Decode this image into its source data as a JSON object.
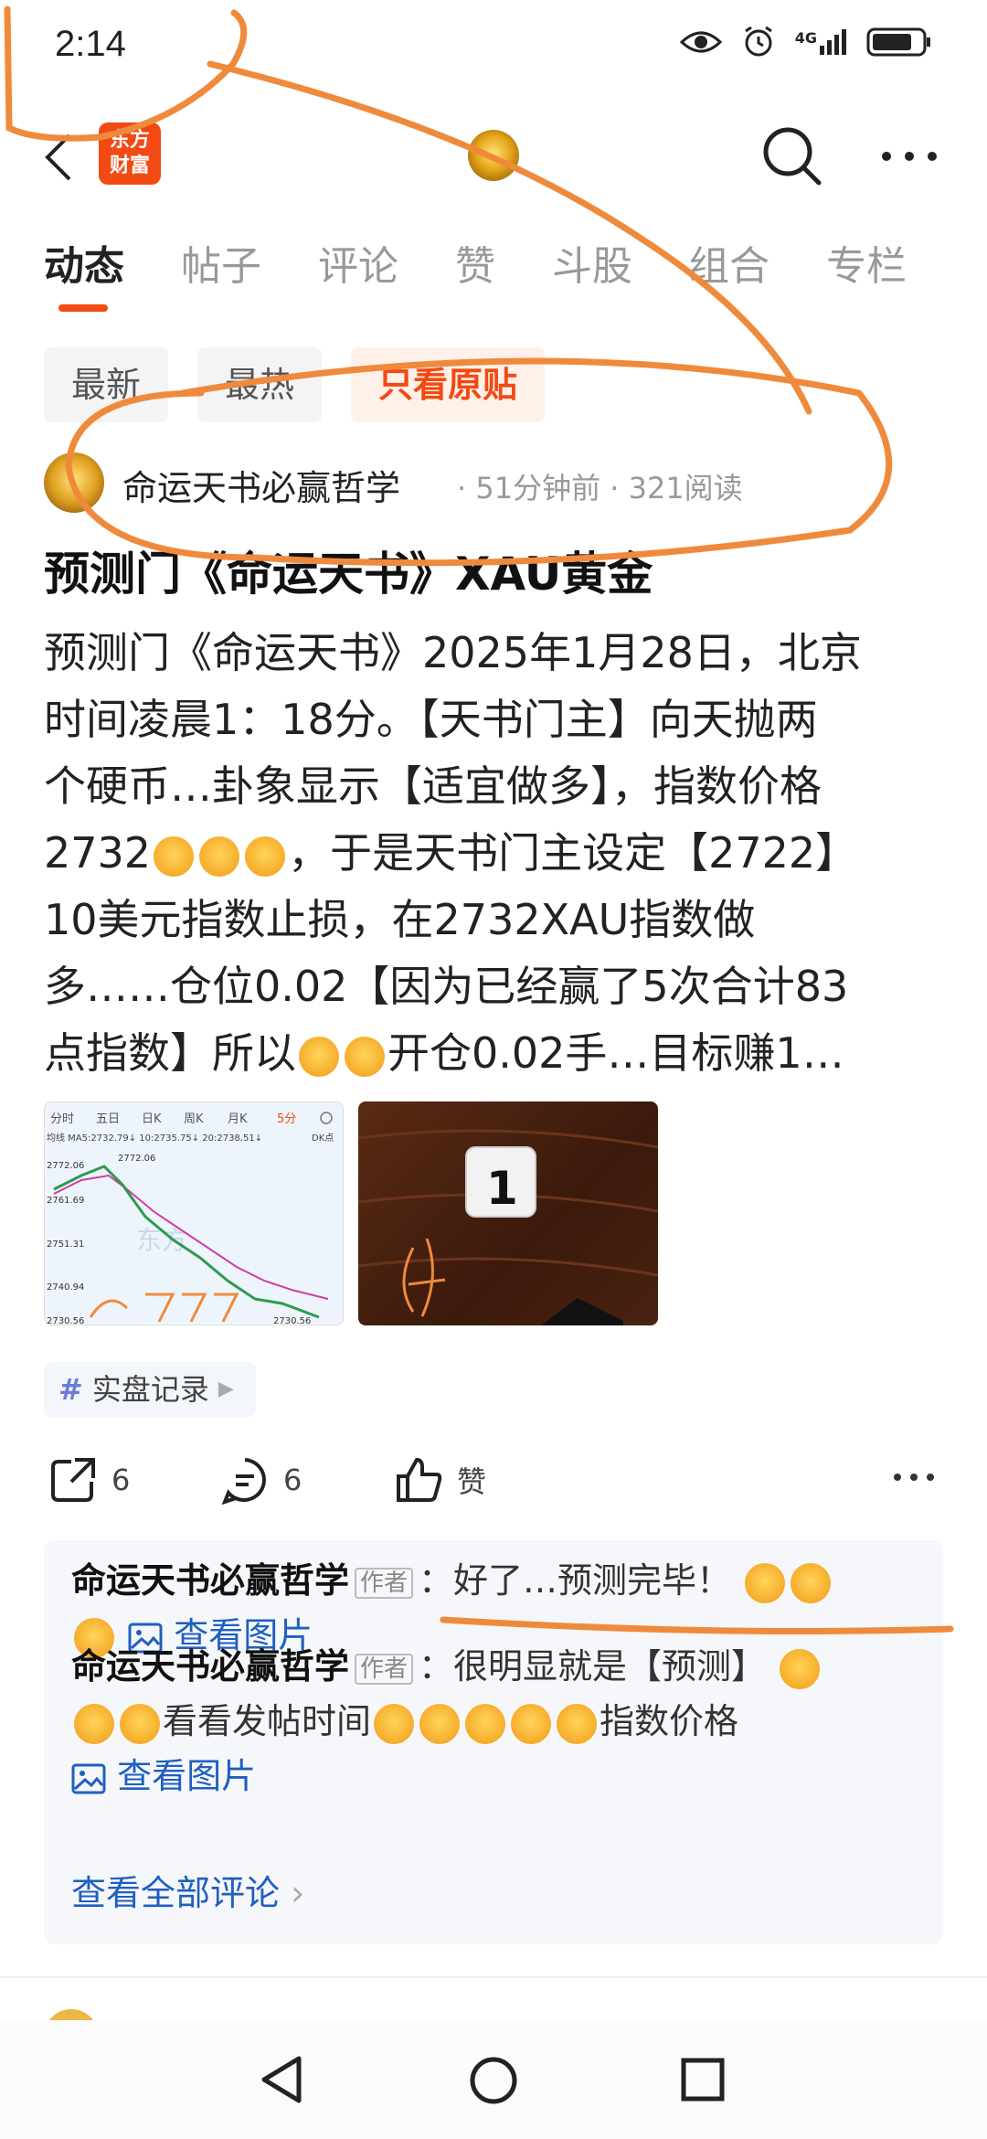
{
  "status_bar": {
    "time": "2:14",
    "network": "4G"
  },
  "app_bar": {
    "brand_line1": "东方",
    "brand_line2": "财富"
  },
  "tabs": [
    {
      "label": "动态",
      "active": true
    },
    {
      "label": "帖子"
    },
    {
      "label": "评论"
    },
    {
      "label": "赞"
    },
    {
      "label": "斗股"
    },
    {
      "label": "组合"
    },
    {
      "label": "专栏"
    }
  ],
  "filters": [
    {
      "label": "最新"
    },
    {
      "label": "最热"
    },
    {
      "label": "只看原贴",
      "active": true
    }
  ],
  "post": {
    "author": "命运天书必赢哲学",
    "time_ago": "51分钟前",
    "reads": "321阅读",
    "title": "预测门《命运天书》XAU黄金",
    "body_lines": [
      "预测门《命运天书》2025年1月28日，北京",
      "时间凌晨1：18分。【天书门主】向天抛两",
      "个硬币…卦象显示【适宜做多】，指数价格",
      "，于是天书门主设定【2722】",
      "10美元指数止损，在2732XAU指数做",
      "多……仓位0.02【因为已经赢了5次合计83",
      "开仓0.02手…目标赚1…"
    ],
    "body_line4_prefix": "2732",
    "body_line7_prefix": "点指数】所以",
    "topic": "实盘记录",
    "shares": "6",
    "comments": "6",
    "like_label": "赞"
  },
  "chart_thumb": {
    "tabs": [
      "分时",
      "五日",
      "日K",
      "周K",
      "月K",
      "5分"
    ],
    "ma_text": "均线 MA5:2732.79↓ 10:2735.75↓ 20:2738.51↓",
    "dk": "DK点",
    "price_high": "2772.06",
    "y_labels": [
      "2772.06",
      "2761.69",
      "2751.31",
      "2740.94",
      "2730.56"
    ],
    "low_label": "2730.56",
    "watermark": "东方"
  },
  "dice_thumb": {
    "face": "1"
  },
  "comments_section": {
    "badge": "作者",
    "c1_author": "命运天书必赢哲学",
    "c1_text": "好了…预测完毕！",
    "c2_author": "命运天书必赢哲学",
    "c2_text": "很明显就是【预测】",
    "c2_mid": "看看发帖时间",
    "c2_end": "指数价格",
    "view_pic": "查看图片",
    "see_all": "查看全部评论"
  },
  "colors": {
    "accent": "#f24a12",
    "link": "#1f5fbf",
    "annotation": "#ef8a3c"
  }
}
